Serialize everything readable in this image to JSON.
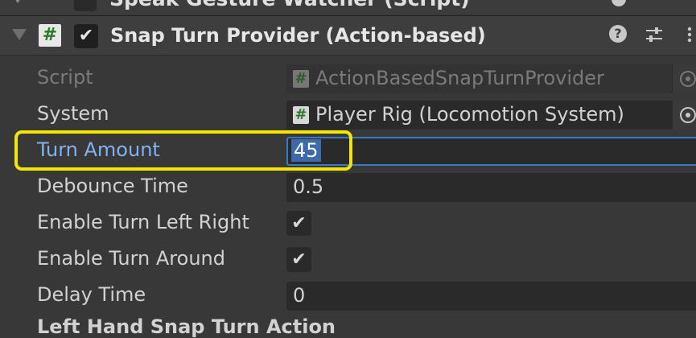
{
  "previous_component": {
    "title": "Speak Gesture Watcher (Script)"
  },
  "component": {
    "title": "Snap Turn Provider (Action-based)",
    "enabled": true,
    "script_icon_glyph": "#",
    "help_glyph": "?",
    "icons": [
      "foldout-icon",
      "script-icon",
      "help-icon",
      "presets-icon",
      "context-menu-icon"
    ]
  },
  "properties": {
    "script": {
      "label": "Script",
      "value": "ActionBasedSnapTurnProvider",
      "icon_glyph": "#"
    },
    "system": {
      "label": "System",
      "value": "Player Rig (Locomotion System)",
      "icon_glyph": "#"
    },
    "turn_amount": {
      "label": "Turn Amount",
      "value": "45"
    },
    "debounce_time": {
      "label": "Debounce Time",
      "value": "0.5"
    },
    "enable_turn_left_right": {
      "label": "Enable Turn Left Right",
      "checked": true,
      "glyph": "✔"
    },
    "enable_turn_around": {
      "label": "Enable Turn Around",
      "checked": true,
      "glyph": "✔"
    },
    "delay_time": {
      "label": "Delay Time",
      "value": "0"
    }
  },
  "next_section": {
    "label": "Left Hand Snap Turn Action"
  },
  "colors": {
    "highlight": "#f5e600",
    "active_label": "#7fb2f0",
    "selection": "#3d6aa8",
    "background": "#383838"
  }
}
